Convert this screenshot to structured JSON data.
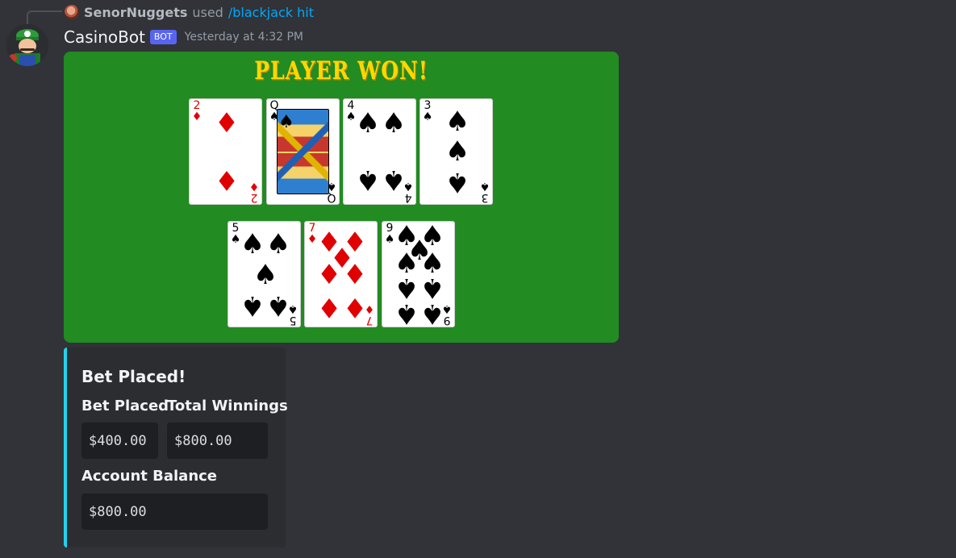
{
  "reply": {
    "username": "SenorNuggets",
    "used_text": "used",
    "command": "/blackjack hit"
  },
  "message": {
    "author": "CasinoBot",
    "badge": "BOT",
    "timestamp": "Yesterday at 4:32 PM"
  },
  "game": {
    "result": "PLAYER WON!",
    "table_color": "#228b22",
    "dealer_cards": [
      {
        "rank": "2",
        "suit": "♦",
        "color": "red"
      },
      {
        "rank": "Q",
        "suit": "♠",
        "color": "black"
      },
      {
        "rank": "4",
        "suit": "♠",
        "color": "black"
      },
      {
        "rank": "3",
        "suit": "♠",
        "color": "black"
      }
    ],
    "player_cards": [
      {
        "rank": "5",
        "suit": "♠",
        "color": "black"
      },
      {
        "rank": "7",
        "suit": "♦",
        "color": "red"
      },
      {
        "rank": "9",
        "suit": "♠",
        "color": "black"
      }
    ]
  },
  "embed": {
    "accent_color": "#22d3ee",
    "title": "Bet Placed!",
    "bet_placed_label": "Bet Placed",
    "bet_placed_value": "$400.00",
    "total_winnings_label": "Total Winnings",
    "total_winnings_value": "$800.00",
    "account_balance_label": "Account Balance",
    "account_balance_value": "$800.00"
  }
}
